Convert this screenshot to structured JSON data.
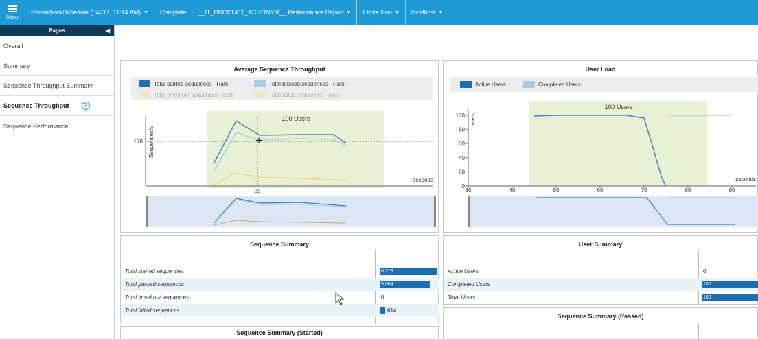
{
  "topbar": {
    "menu_label": "Menu",
    "schedule": "PhoneBookSchedule (8/4/17, 11:14 AM)",
    "status": "Complete",
    "report": "__IT_PRODUCT_ACRONYM__ Performance Report",
    "run": "Entire Run",
    "host": "localhost"
  },
  "sidebar": {
    "header": "Pages",
    "items": [
      {
        "label": "Overall"
      },
      {
        "label": "Summary"
      },
      {
        "label": "Sequence Throughput Summary"
      },
      {
        "label": "Sequence Throughput"
      },
      {
        "label": "Sequence Performance"
      }
    ],
    "help_glyph": "?"
  },
  "throughput_chart": {
    "title": "Average Sequence Throughput",
    "legend": [
      "Total started sequences - Rate",
      "Total passed sequences - Rate",
      "Total timed out sequences - Rate",
      "Total failed sequences - Rate"
    ],
    "band_label": "100 Users",
    "y_label": "Sequences/s",
    "x_label": "seconds",
    "cursor_y_label": "178",
    "cursor_x_label": "55"
  },
  "userload_chart": {
    "title": "User Load",
    "legend": [
      "Active Users",
      "Completed Users"
    ],
    "band_label": "100 Users",
    "y_label": "users",
    "x_label": "seconds",
    "y_ticks": [
      "100",
      "80",
      "60",
      "40",
      "20",
      "0"
    ],
    "x_ticks": [
      "30",
      "40",
      "50",
      "60",
      "70",
      "80",
      "90"
    ]
  },
  "chart_data": [
    {
      "type": "line",
      "title": "Average Sequence Throughput",
      "ylabel": "Sequences/s",
      "xlabel": "seconds",
      "x": [
        47,
        52,
        56,
        62,
        68,
        71
      ],
      "series": [
        {
          "name": "Total started sequences - Rate",
          "values": [
            40,
            205,
            178,
            180,
            181,
            155
          ]
        },
        {
          "name": "Total passed sequences - Rate",
          "values": [
            30,
            190,
            172,
            174,
            174,
            150
          ]
        },
        {
          "name": "Total timed out sequences - Rate",
          "values": [
            0,
            0,
            0,
            0,
            0,
            0
          ]
        },
        {
          "name": "Total failed sequences - Rate",
          "values": [
            5,
            30,
            20,
            16,
            13,
            10
          ]
        }
      ]
    },
    {
      "type": "line",
      "title": "User Load",
      "ylabel": "users",
      "xlabel": "seconds",
      "xlim": [
        30,
        92
      ],
      "ylim": [
        0,
        100
      ],
      "series": [
        {
          "name": "Active Users",
          "x": [
            45,
            50,
            60,
            66,
            70,
            72,
            74,
            75
          ],
          "values": [
            99,
            100,
            100,
            100,
            96,
            55,
            12,
            0
          ]
        },
        {
          "name": "Completed Users",
          "x": [
            76,
            84,
            90
          ],
          "values": [
            100,
            100,
            100
          ]
        }
      ]
    }
  ],
  "sequence_summary": {
    "title": "Sequence Summary",
    "rows": [
      {
        "label": "Total started sequences",
        "value": "6,278",
        "frac": 1.0
      },
      {
        "label": "Total passed sequences",
        "value": "5,664",
        "frac": 0.9
      },
      {
        "label": "Total timed out sequences",
        "value": "0",
        "frac": 0
      },
      {
        "label": "Total failed sequences",
        "value": "614",
        "frac": 0.1
      }
    ]
  },
  "user_summary": {
    "title": "User Summary",
    "rows": [
      {
        "label": "Active Users",
        "value": "0",
        "frac": 0
      },
      {
        "label": "Completed Users",
        "value": "100",
        "frac": 1.0
      },
      {
        "label": "Total Users",
        "value": "100",
        "frac": 1.0
      }
    ]
  },
  "bottom_panels": {
    "started_title": "Sequence Summary (Started)",
    "passed_title": "Sequence Summary (Passed)"
  },
  "colors": {
    "accent": "#1f9ad6",
    "bar": "#1f6fb0",
    "band": "#e6f2d3",
    "nav_head": "#103a5a"
  }
}
